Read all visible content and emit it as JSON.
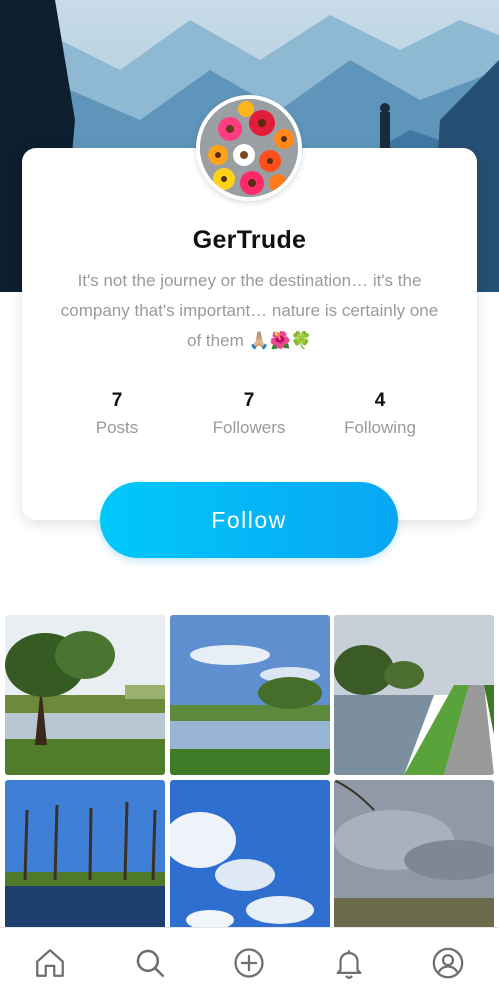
{
  "profile": {
    "name": "GerTrude",
    "bio": "It's not the journey or the destination… it's the company that's important… nature is certainly one of them 🙏🏼🌺🍀"
  },
  "stats": [
    {
      "value": "7",
      "label": "Posts"
    },
    {
      "value": "7",
      "label": "Followers"
    },
    {
      "value": "4",
      "label": "Following"
    }
  ],
  "actions": {
    "follow_label": "Follow"
  },
  "nav": [
    {
      "icon": "home-icon"
    },
    {
      "icon": "search-icon"
    },
    {
      "icon": "add-icon"
    },
    {
      "icon": "bell-icon"
    },
    {
      "icon": "profile-icon"
    }
  ],
  "colors": {
    "accent": "#0aa6f3",
    "muted": "#9a9a9a",
    "icon": "#6f6f6f"
  }
}
